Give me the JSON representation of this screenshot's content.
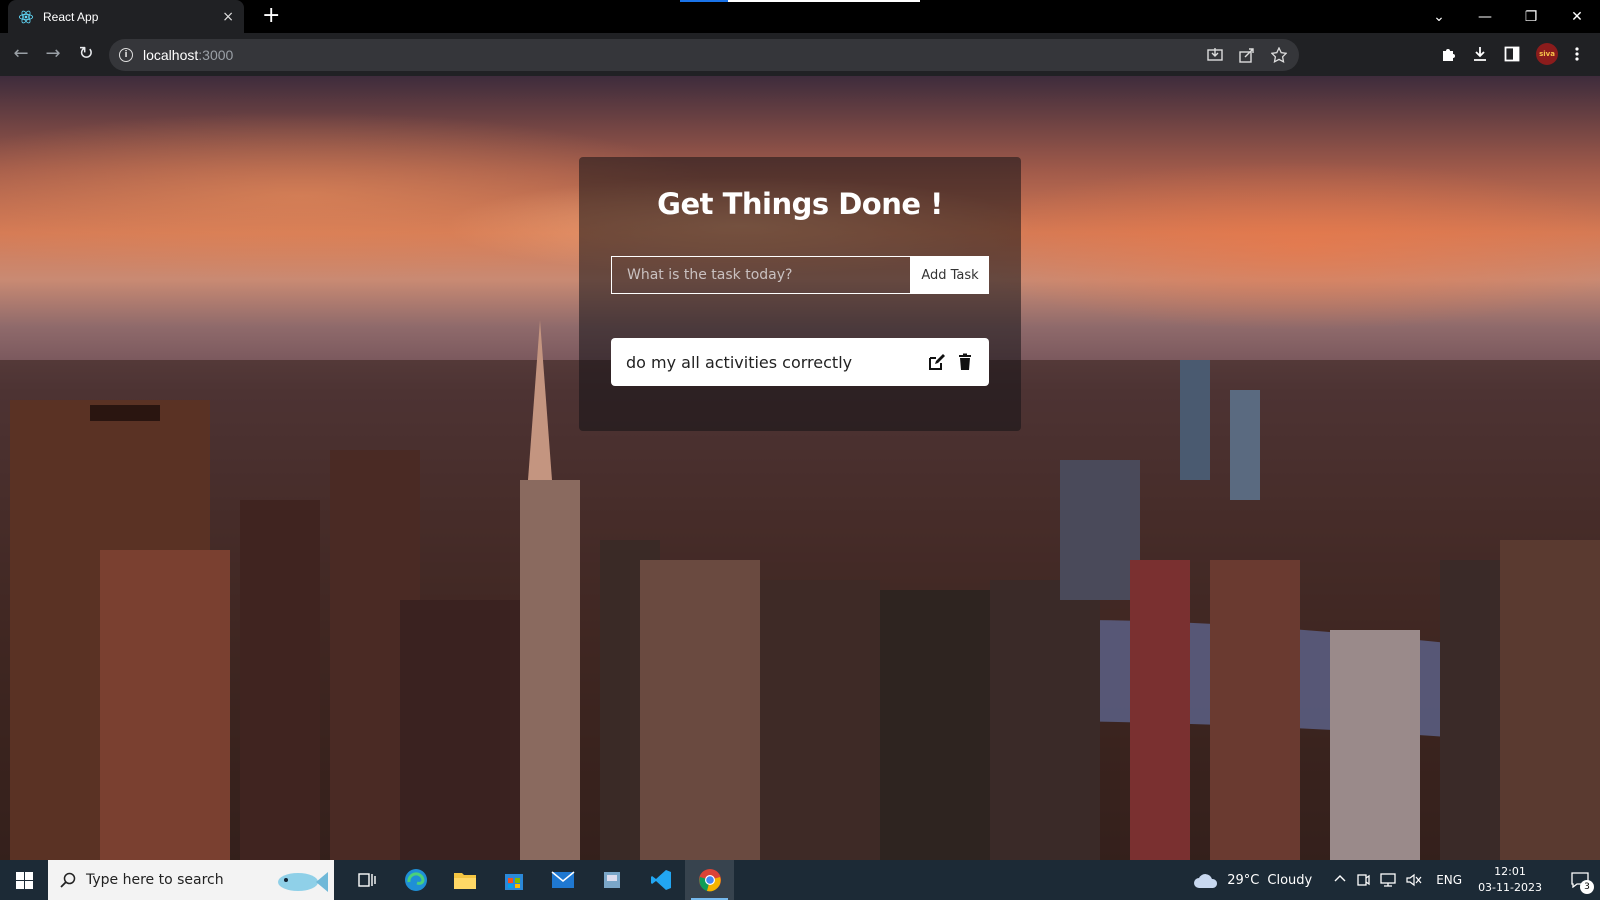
{
  "browser": {
    "tab_title": "React App",
    "tab_close": "×",
    "new_tab": "+",
    "url_host": "localhost",
    "url_port": ":3000",
    "info_glyph": "i",
    "back_glyph": "←",
    "forward_glyph": "→",
    "reload_glyph": "↻",
    "avatar_text": "siva",
    "window_controls": {
      "tabs": "⌄",
      "minimize": "—",
      "restore": "❐",
      "close": "✕"
    }
  },
  "app": {
    "title": "Get Things Done !",
    "input_placeholder": "What is the task today?",
    "add_button": "Add Task",
    "tasks": [
      {
        "text": "do my all activities correctly"
      }
    ]
  },
  "taskbar": {
    "search_placeholder": "Type here to search",
    "weather_temp": "29°C",
    "weather_text": "Cloudy",
    "language": "ENG",
    "time": "12:01",
    "date": "03-11-2023",
    "notification_count": "3"
  },
  "colors": {
    "chrome_bg": "#202124",
    "taskbar_bg": "#1c2a36",
    "card_overlay": "rgba(20,18,22,0.55)",
    "accent_blue": "#1a73e8"
  }
}
